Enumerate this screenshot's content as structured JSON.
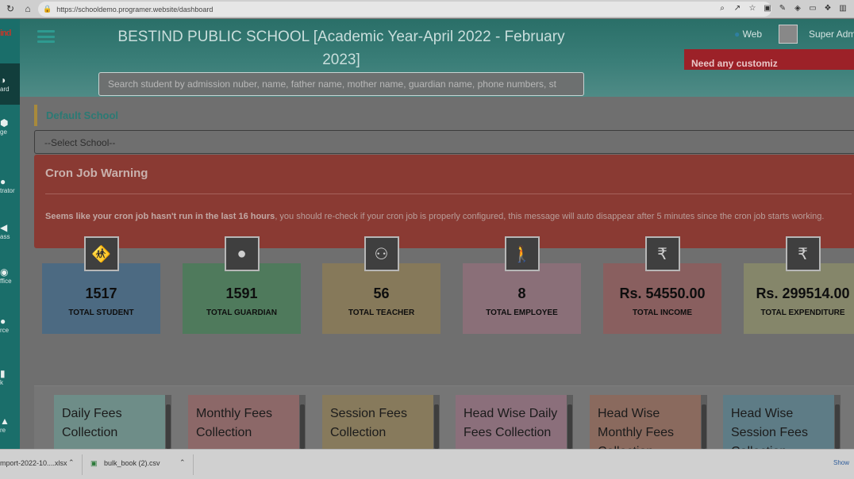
{
  "browser": {
    "url": "https://schooldemo.programer.website/dashboard"
  },
  "sidebar": {
    "logo": "ind",
    "items": [
      {
        "label": "ard",
        "icon": "dashboard-icon"
      },
      {
        "label": "ge",
        "icon": "manage-icon"
      },
      {
        "label": "trator",
        "icon": "administrator-icon"
      },
      {
        "label": "ass",
        "icon": "class-icon"
      },
      {
        "label": "ffice",
        "icon": "office-icon"
      },
      {
        "label": "rce",
        "icon": "resource-icon"
      },
      {
        "label": "k",
        "icon": "book-icon"
      },
      {
        "label": "re",
        "icon": "more-icon"
      }
    ]
  },
  "header": {
    "title": "BESTIND PUBLIC SCHOOL [Academic Year-April 2022 - February 2023]",
    "web_label": "Web",
    "user_label": "Super Adm",
    "promo_text": "Need any customiz",
    "search_placeholder": "Search student by admission nuber, name, father name, mother name, guardian name, phone numbers, st"
  },
  "main": {
    "section_title": "Default School",
    "school_select": "--Select School--",
    "cron": {
      "title": "Cron Job Warning",
      "bold_msg": "Seems like your cron job hasn't run in the last 16 hours",
      "rest_msg": ", you should re-check if your cron job is properly configured, this message will auto disappear after 5 minutes since the cron job starts working."
    },
    "stats": [
      {
        "value": "1517",
        "label": "TOTAL STUDENT",
        "icon": "child-icon",
        "color": "#4c6a82"
      },
      {
        "value": "1591",
        "label": "TOTAL GUARDIAN",
        "icon": "user-icon",
        "color": "#4f7a5c"
      },
      {
        "value": "56",
        "label": "TOTAL TEACHER",
        "icon": "users-icon",
        "color": "#86795a"
      },
      {
        "value": "8",
        "label": "TOTAL EMPLOYEE",
        "icon": "employee-icon",
        "color": "#8a6f78"
      },
      {
        "value": "Rs. 54550.00",
        "label": "TOTAL INCOME",
        "icon": "rupee-icon",
        "color": "#895f5f"
      },
      {
        "value": "Rs. 299514.00",
        "label": "TOTAL EXPENDITURE",
        "icon": "rupee-icon",
        "color": "#85866a"
      }
    ],
    "fee_cards": [
      {
        "title": "Daily Fees Collection",
        "color": "#6e8d88"
      },
      {
        "title": "Monthly Fees Collection",
        "color": "#8c6868"
      },
      {
        "title": "Session Fees Collection",
        "color": "#877a5c"
      },
      {
        "title": "Head Wise Daily Fees Collection",
        "color": "#8b6f7b"
      },
      {
        "title": "Head Wise Monthly Fees Collection",
        "color": "#8a6a5e"
      },
      {
        "title": "Head Wise Session Fees Collection",
        "color": "#5e7c86"
      }
    ]
  },
  "downloads": {
    "items": [
      "mport-2022-10....xlsx",
      "bulk_book (2).csv"
    ],
    "show_all": "Show"
  }
}
